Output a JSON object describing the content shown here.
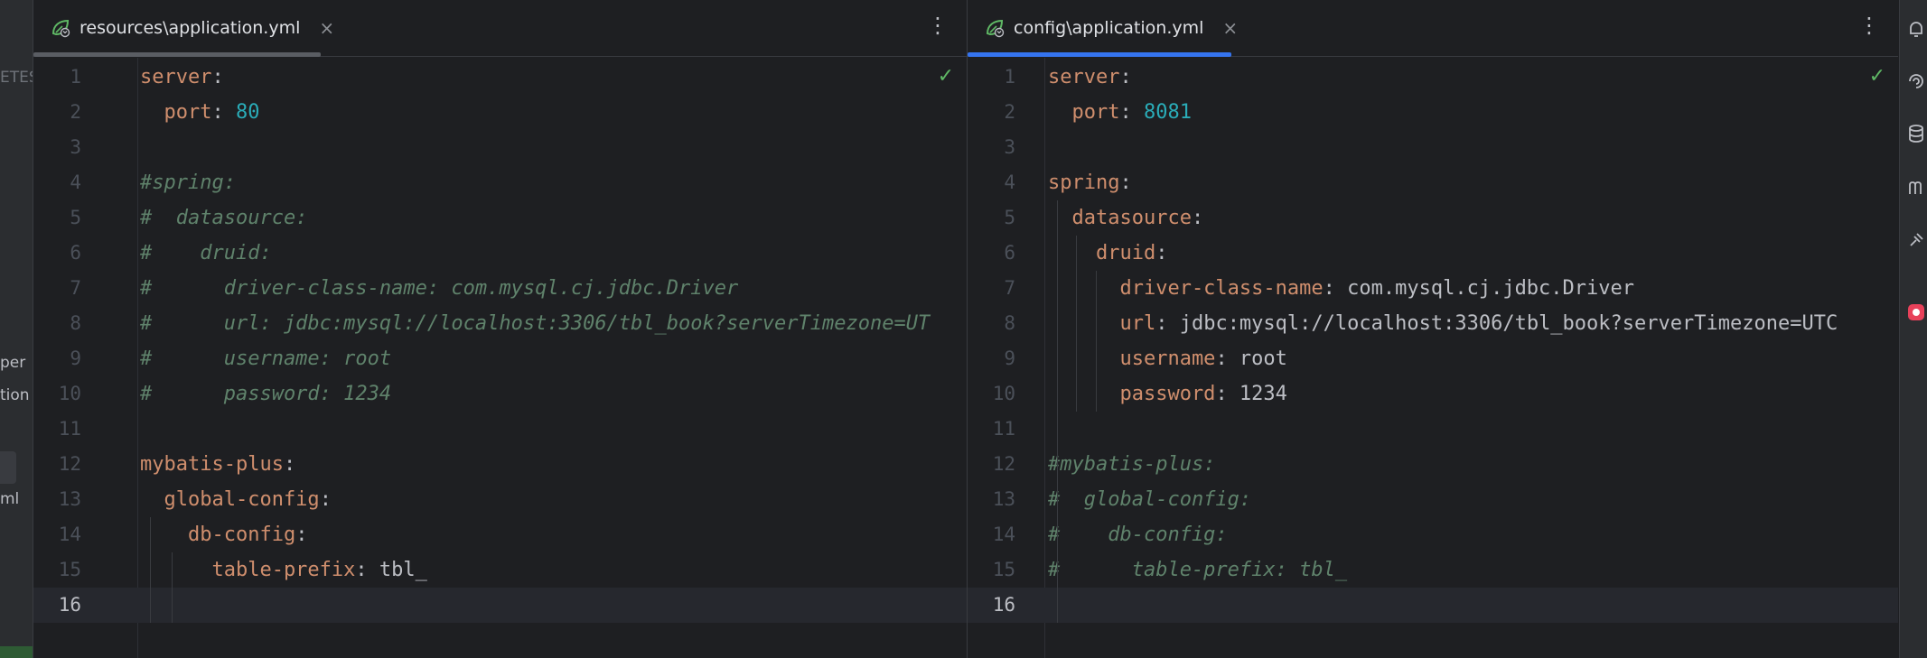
{
  "sidebar_fragments": {
    "test_label": "ETEST",
    "item_1": "per",
    "item_2": "tion",
    "item_3": "ml"
  },
  "left_tab": {
    "title": "resources\\application.yml",
    "close_glyph": "×",
    "menu_glyph": "⋮",
    "icon": "yaml-spring-icon"
  },
  "right_tab": {
    "title": "config\\application.yml",
    "close_glyph": "×",
    "menu_glyph": "⋮",
    "icon": "yaml-spring-icon"
  },
  "inspection_status": "✓",
  "left_editor": {
    "current_line": 16,
    "lines": [
      [
        {
          "t": "server",
          "c": "k"
        },
        {
          "t": ":",
          "c": "p"
        }
      ],
      [
        {
          "t": "  port",
          "c": "k"
        },
        {
          "t": ": ",
          "c": "p"
        },
        {
          "t": "80",
          "c": "n"
        }
      ],
      [],
      [
        {
          "t": "#spring:",
          "c": "c"
        }
      ],
      [
        {
          "t": "#  datasource:",
          "c": "c"
        }
      ],
      [
        {
          "t": "#    druid:",
          "c": "c"
        }
      ],
      [
        {
          "t": "#      driver-class-name: com.mysql.cj.jdbc.Driver",
          "c": "c"
        }
      ],
      [
        {
          "t": "#      url: jdbc:mysql://localhost:3306/tbl_book?serverTimezone=UT",
          "c": "c"
        }
      ],
      [
        {
          "t": "#      username: root",
          "c": "c"
        }
      ],
      [
        {
          "t": "#      password: 1234",
          "c": "c"
        }
      ],
      [],
      [
        {
          "t": "mybatis-plus",
          "c": "k"
        },
        {
          "t": ":",
          "c": "p"
        }
      ],
      [
        {
          "t": "  global-config",
          "c": "k"
        },
        {
          "t": ":",
          "c": "p"
        }
      ],
      [
        {
          "t": "    db-config",
          "c": "k"
        },
        {
          "t": ":",
          "c": "p"
        }
      ],
      [
        {
          "t": "      table-prefix",
          "c": "k"
        },
        {
          "t": ": tbl_",
          "c": "p"
        }
      ],
      []
    ]
  },
  "right_editor": {
    "current_line": 16,
    "lines": [
      [
        {
          "t": "server",
          "c": "k"
        },
        {
          "t": ":",
          "c": "p"
        }
      ],
      [
        {
          "t": "  port",
          "c": "k"
        },
        {
          "t": ": ",
          "c": "p"
        },
        {
          "t": "8081",
          "c": "n"
        }
      ],
      [],
      [
        {
          "t": "spring",
          "c": "k"
        },
        {
          "t": ":",
          "c": "p"
        }
      ],
      [
        {
          "t": "  datasource",
          "c": "k"
        },
        {
          "t": ":",
          "c": "p"
        }
      ],
      [
        {
          "t": "    druid",
          "c": "k"
        },
        {
          "t": ":",
          "c": "p"
        }
      ],
      [
        {
          "t": "      driver-class-name",
          "c": "k"
        },
        {
          "t": ": com.mysql.cj.jdbc.Driver",
          "c": "p"
        }
      ],
      [
        {
          "t": "      url",
          "c": "k"
        },
        {
          "t": ": jdbc:mysql://localhost:3306/tbl_book?serverTimezone=UTC",
          "c": "p"
        }
      ],
      [
        {
          "t": "      username",
          "c": "k"
        },
        {
          "t": ": root",
          "c": "p"
        }
      ],
      [
        {
          "t": "      password",
          "c": "k"
        },
        {
          "t": ": 1234",
          "c": "p"
        }
      ],
      [],
      [
        {
          "t": "#mybatis-plus:",
          "c": "c"
        }
      ],
      [
        {
          "t": "#  global-config:",
          "c": "c"
        }
      ],
      [
        {
          "t": "#    db-config:",
          "c": "c"
        }
      ],
      [
        {
          "t": "#      table-prefix: tbl_",
          "c": "c"
        }
      ],
      []
    ]
  },
  "right_toolbar": [
    "notifications-icon",
    "ai-assistant-icon",
    "database-icon",
    "maven-icon",
    "plugin-icon",
    "app-icon"
  ]
}
